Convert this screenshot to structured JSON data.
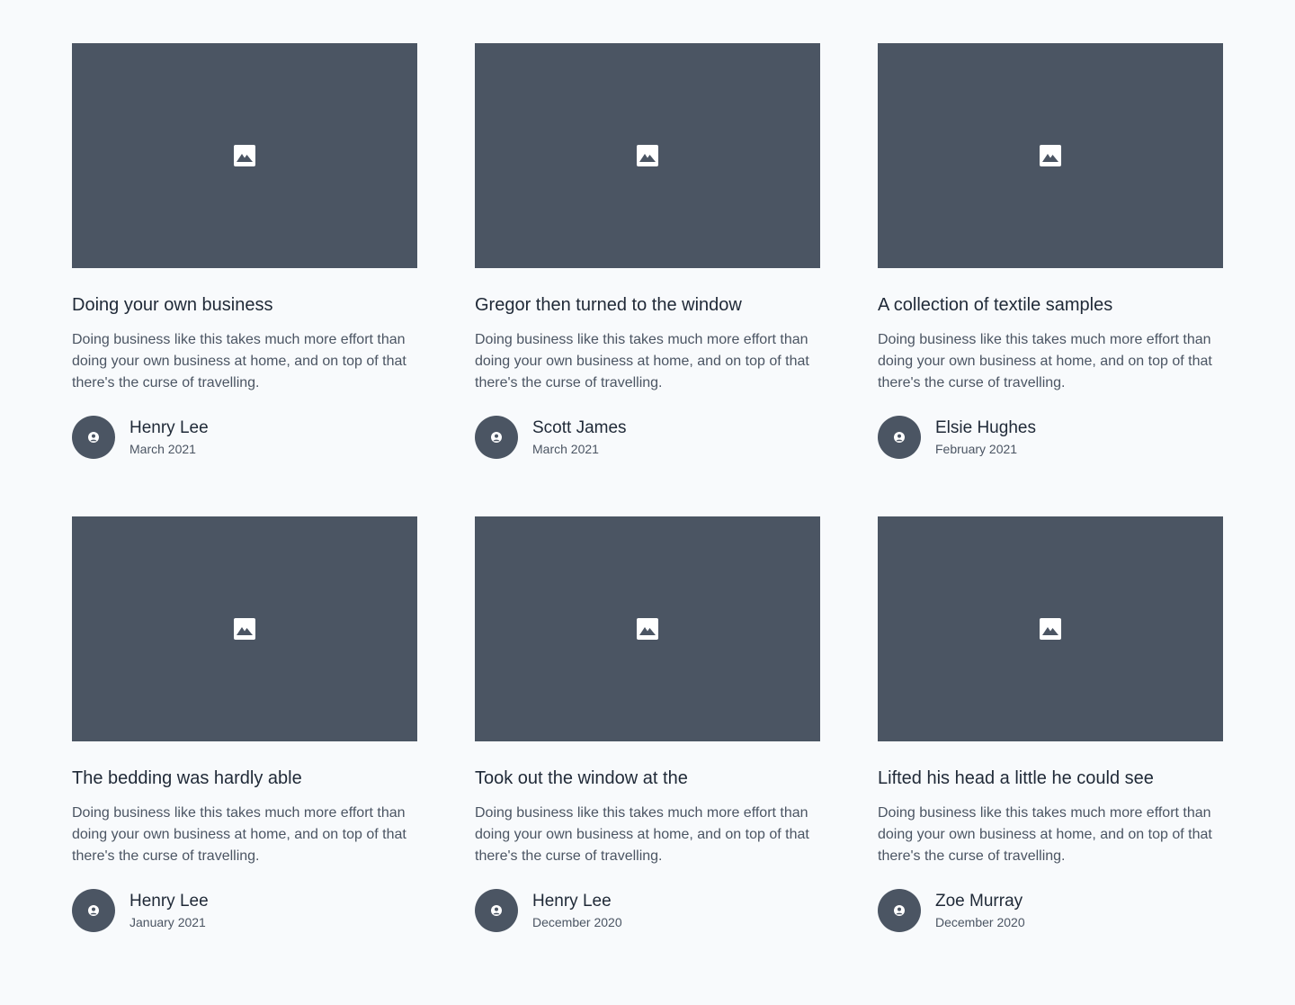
{
  "colors": {
    "background": "#f8fafc",
    "placeholder": "#4b5563",
    "title": "#1f2937",
    "body": "#4b5563"
  },
  "posts": [
    {
      "title": "Doing your own business",
      "excerpt": "Doing business like this takes much more effort than doing your own business at home, and on top of that there's the curse of travelling.",
      "author": "Henry Lee",
      "date": "March 2021",
      "image_icon": "image-icon",
      "avatar_icon": "user-icon"
    },
    {
      "title": "Gregor then turned to the window",
      "excerpt": "Doing business like this takes much more effort than doing your own business at home, and on top of that there's the curse of travelling.",
      "author": "Scott James",
      "date": "March 2021",
      "image_icon": "image-icon",
      "avatar_icon": "user-icon"
    },
    {
      "title": "A collection of textile samples",
      "excerpt": "Doing business like this takes much more effort than doing your own business at home, and on top of that there's the curse of travelling.",
      "author": "Elsie Hughes",
      "date": "February 2021",
      "image_icon": "image-icon",
      "avatar_icon": "user-icon"
    },
    {
      "title": "The bedding was hardly able",
      "excerpt": "Doing business like this takes much more effort than doing your own business at home, and on top of that there's the curse of travelling.",
      "author": "Henry Lee",
      "date": "January 2021",
      "image_icon": "image-icon",
      "avatar_icon": "user-icon"
    },
    {
      "title": "Took out the window at the",
      "excerpt": "Doing business like this takes much more effort than doing your own business at home, and on top of that there's the curse of travelling.",
      "author": "Henry Lee",
      "date": "December 2020",
      "image_icon": "image-icon",
      "avatar_icon": "user-icon"
    },
    {
      "title": "Lifted his head a little he could see",
      "excerpt": "Doing business like this takes much more effort than doing your own business at home, and on top of that there's the curse of travelling.",
      "author": "Zoe Murray",
      "date": "December 2020",
      "image_icon": "image-icon",
      "avatar_icon": "user-icon"
    }
  ]
}
